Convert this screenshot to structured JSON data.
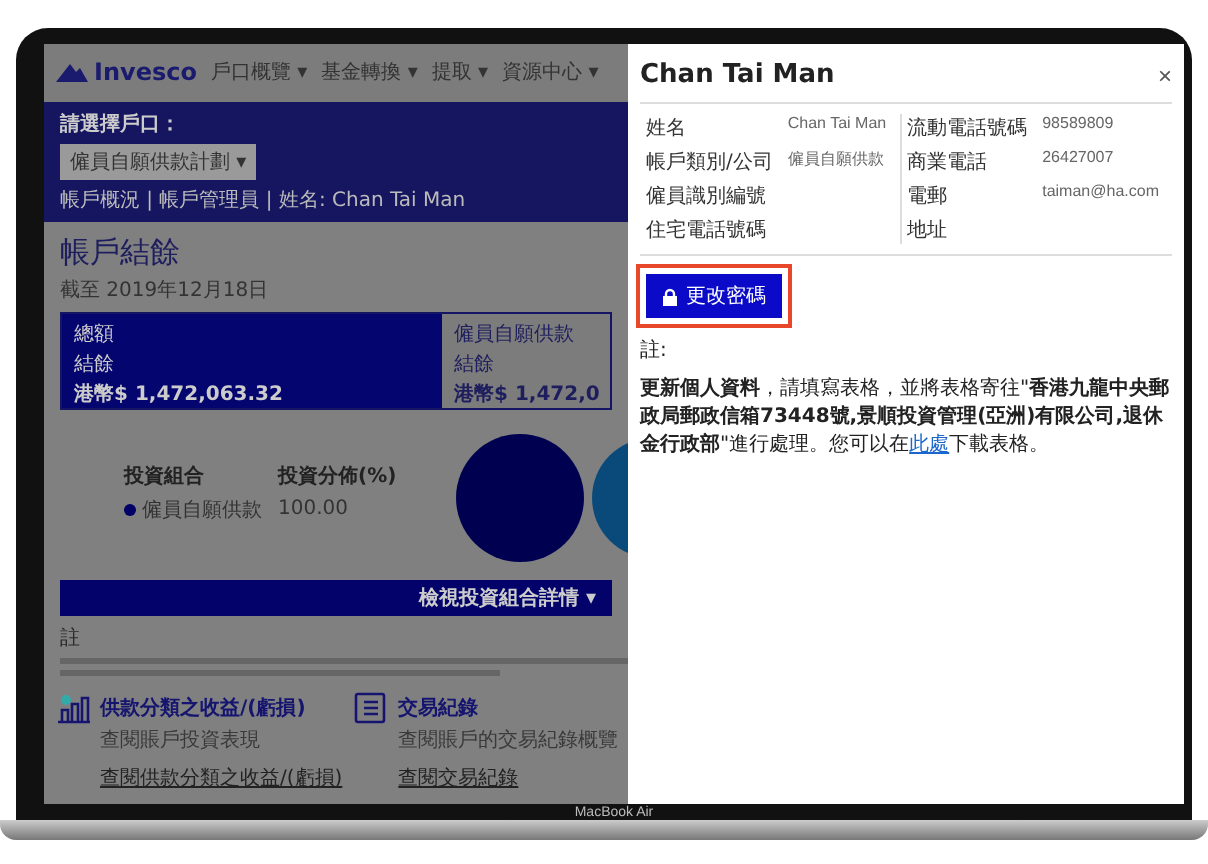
{
  "device": {
    "label": "MacBook Air"
  },
  "page": {
    "logo": "Invesco",
    "nav": [
      {
        "label": "戶口概覽 ▾"
      },
      {
        "label": "基金轉換 ▾"
      },
      {
        "label": "提取 ▾"
      },
      {
        "label": "資源中心 ▾"
      }
    ],
    "banner": {
      "account_label": "請選擇戶口：",
      "account_select": "僱員自願供款計劃 ▾",
      "breadcrumb": "帳戶概況 | 帳戶管理員 | 姓名: Chan Tai Man"
    },
    "title": "帳戶結餘",
    "date": "截至 2019年12月18日",
    "cards": [
      {
        "heading": "總額",
        "label": "結餘",
        "amount": "港幣$ 1,472,063.32",
        "selected": true
      },
      {
        "heading": "僱員自願供款",
        "label": "結餘",
        "amount": "港幣$ 1,472,0",
        "selected": false
      }
    ],
    "legend": {
      "columns": [
        "投資組合",
        "投資分佈(%)"
      ],
      "items": [
        {
          "name": "僱員自願供款",
          "value": "100.00",
          "color": "#000066"
        }
      ]
    },
    "details_bar": "檢視投資組合詳情 ▾",
    "notes_label": "註",
    "links": [
      {
        "title": "供款分類之收益/(虧損)",
        "subtitle": "查閱賬戶投資表現",
        "link": "查閱供款分類之收益/(虧損)"
      },
      {
        "title": "交易紀錄",
        "subtitle": "查閱賬戶的交易紀錄概覽",
        "link": "查閱交易紀錄"
      }
    ]
  },
  "modal": {
    "title": "Chan Tai Man",
    "close": "×",
    "fields_left": [
      {
        "label": "姓名",
        "value": "Chan Tai Man"
      },
      {
        "label": "帳戶類別/公司",
        "value": "僱員自願供款"
      },
      {
        "label": "僱員識別編號"
      },
      {
        "label": "住宅電話號碼"
      }
    ],
    "fields_right": [
      {
        "label": "流動電話號碼",
        "value": "98589809"
      },
      {
        "label": "商業電話",
        "value": "26427007"
      },
      {
        "label": "電郵",
        "value": "taiman@ha.com"
      },
      {
        "label": "地址"
      }
    ],
    "button": {
      "label": "更改密碼",
      "highlighted": true
    },
    "note_label": "註:",
    "note_before": "**更新個人資料**，請填寫表格，並將表格寄往\"**香港九龍中央郵政局郵政信箱73448號,景順投資管理(亞洲)有限公司,退休金行政部**\"進行處理。您可以在",
    "note_link": "此處",
    "note_after": "下載表格。"
  }
}
